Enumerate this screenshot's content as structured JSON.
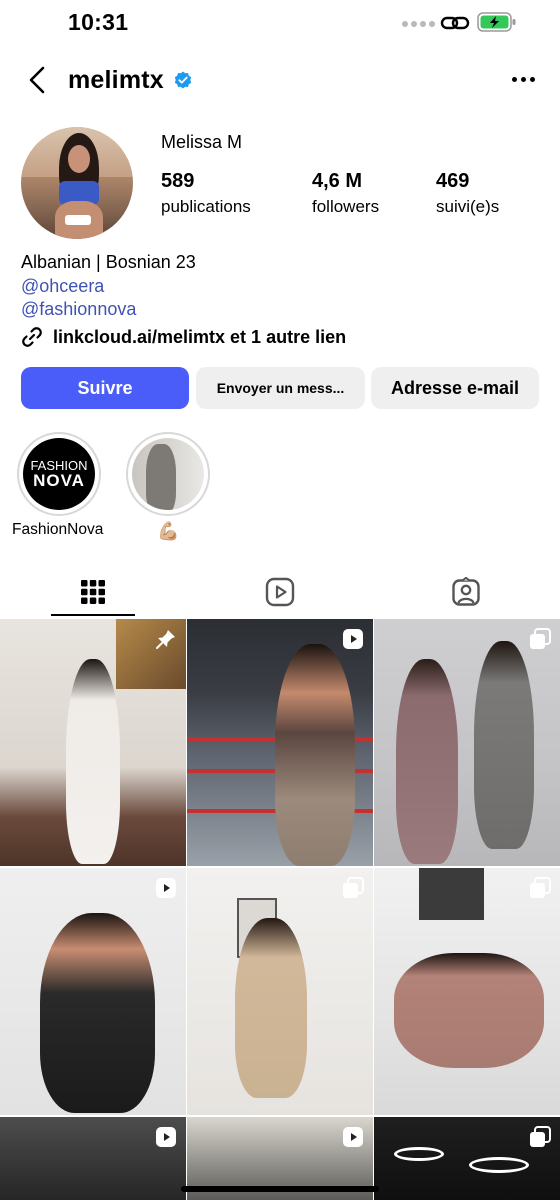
{
  "status_bar": {
    "time": "10:31",
    "battery_state": "charging",
    "battery_color": "#34c759"
  },
  "header": {
    "username": "melimtx",
    "verified": true,
    "verified_color": "#1d9bf0"
  },
  "profile": {
    "display_name": "Melissa M",
    "stats": {
      "posts": {
        "value": "589",
        "label": "publications"
      },
      "followers": {
        "value": "4,6 M",
        "label": "followers"
      },
      "following": {
        "value": "469",
        "label": "suivi(e)s"
      }
    },
    "bio": {
      "line1": "Albanian | Bosnian 23",
      "mention1": "@ohceera",
      "mention2": "@fashionnova"
    },
    "link": "linkcloud.ai/melimtx et 1 autre lien"
  },
  "actions": {
    "follow": "Suivre",
    "message": "Envoyer un mess...",
    "email": "Adresse e-mail",
    "accent_color": "#4a5df9"
  },
  "highlights": [
    {
      "label": "FashionNova",
      "cover_text_top": "FASHION",
      "cover_text_bottom": "NOVA"
    },
    {
      "label": "💪🏼"
    }
  ],
  "tabs": [
    {
      "name": "grid",
      "icon": "grid-icon",
      "active": true
    },
    {
      "name": "reels",
      "icon": "reels-icon",
      "active": false
    },
    {
      "name": "tagged",
      "icon": "tagged-icon",
      "active": false
    }
  ],
  "grid_badges": [
    "pinned-icon",
    "reel-icon",
    "carousel-icon",
    "reel-icon",
    "carousel-icon",
    "carousel-icon",
    "reel-icon",
    "reel-icon",
    "carousel-icon"
  ]
}
